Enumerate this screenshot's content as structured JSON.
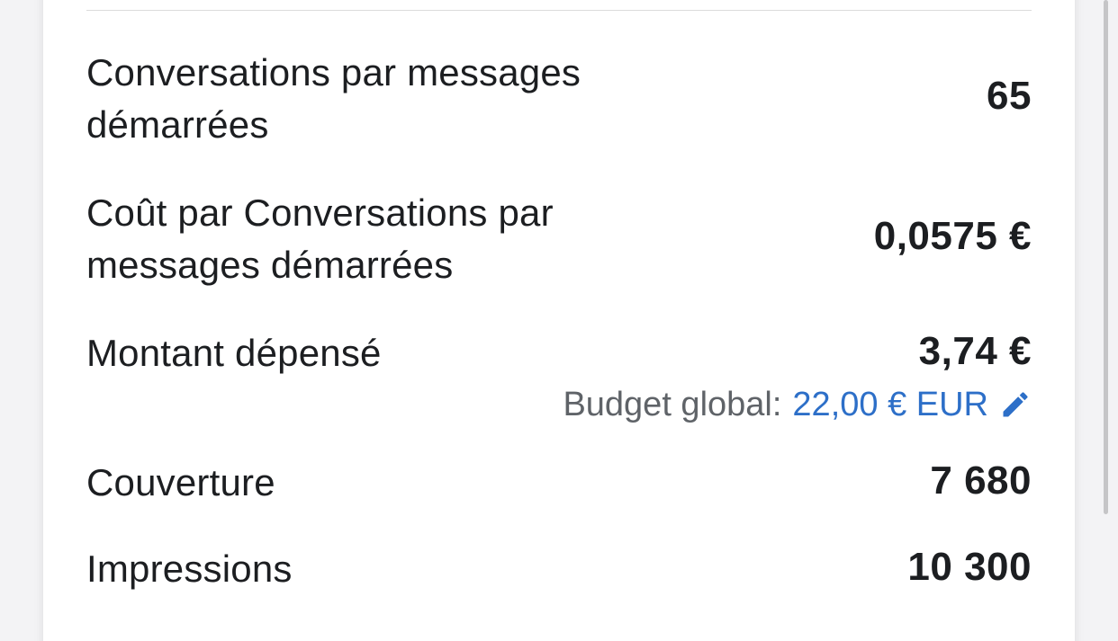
{
  "metrics": [
    {
      "label": "Conversations par messages démarrées",
      "value": "65"
    },
    {
      "label": "Coût par Conversations par messages démarrées",
      "value": "0,0575 €"
    },
    {
      "label": "Montant dépensé",
      "value": "3,74 €"
    },
    {
      "label": "Couverture",
      "value": "7 680"
    },
    {
      "label": "Impressions",
      "value": "10 300"
    }
  ],
  "budget": {
    "label": "Budget global:",
    "value": "22,00 € EUR",
    "icon": "pencil-icon"
  },
  "colors": {
    "text": "#1c1e21",
    "muted": "#5f6368",
    "link": "#2d6fc8",
    "divider": "#dcdcdc",
    "background": "#f3f3f5",
    "card": "#ffffff"
  }
}
